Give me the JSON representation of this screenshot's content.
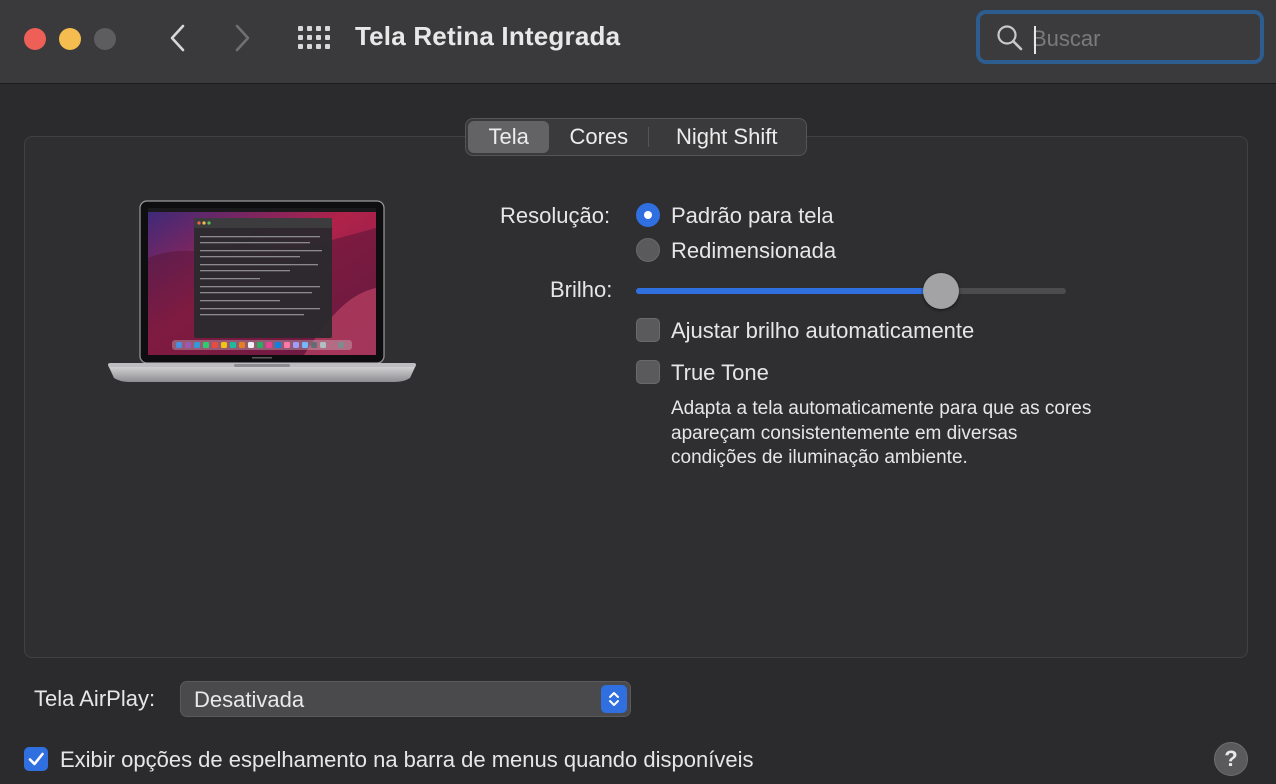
{
  "window": {
    "title": "Tela Retina Integrada",
    "search_placeholder": "Buscar"
  },
  "tabs": [
    {
      "label": "Tela",
      "selected": true
    },
    {
      "label": "Cores",
      "selected": false
    },
    {
      "label": "Night Shift",
      "selected": false
    }
  ],
  "display": {
    "resolution_label": "Resolução:",
    "resolution_options": [
      {
        "label": "Padrão para tela",
        "selected": true
      },
      {
        "label": "Redimensionada",
        "selected": false
      }
    ],
    "brightness_label": "Brilho:",
    "brightness_level": 0.71,
    "auto_brightness": {
      "label": "Ajustar brilho automaticamente",
      "checked": false
    },
    "true_tone": {
      "label": "True Tone",
      "checked": false,
      "description": "Adapta a tela automaticamente para que as cores apareçam consistentemente em diversas condições de iluminação ambiente."
    }
  },
  "airplay": {
    "label": "Tela AirPlay:",
    "value": "Desativada"
  },
  "mirroring": {
    "label": "Exibir opções de espelhamento na barra de menus quando disponíveis",
    "checked": true
  },
  "help_label": "?",
  "colors": {
    "accent": "#2f6fe0",
    "close": "#ee5f57",
    "minimize": "#f5bd4f",
    "zoom_disabled": "#5d5d60"
  }
}
